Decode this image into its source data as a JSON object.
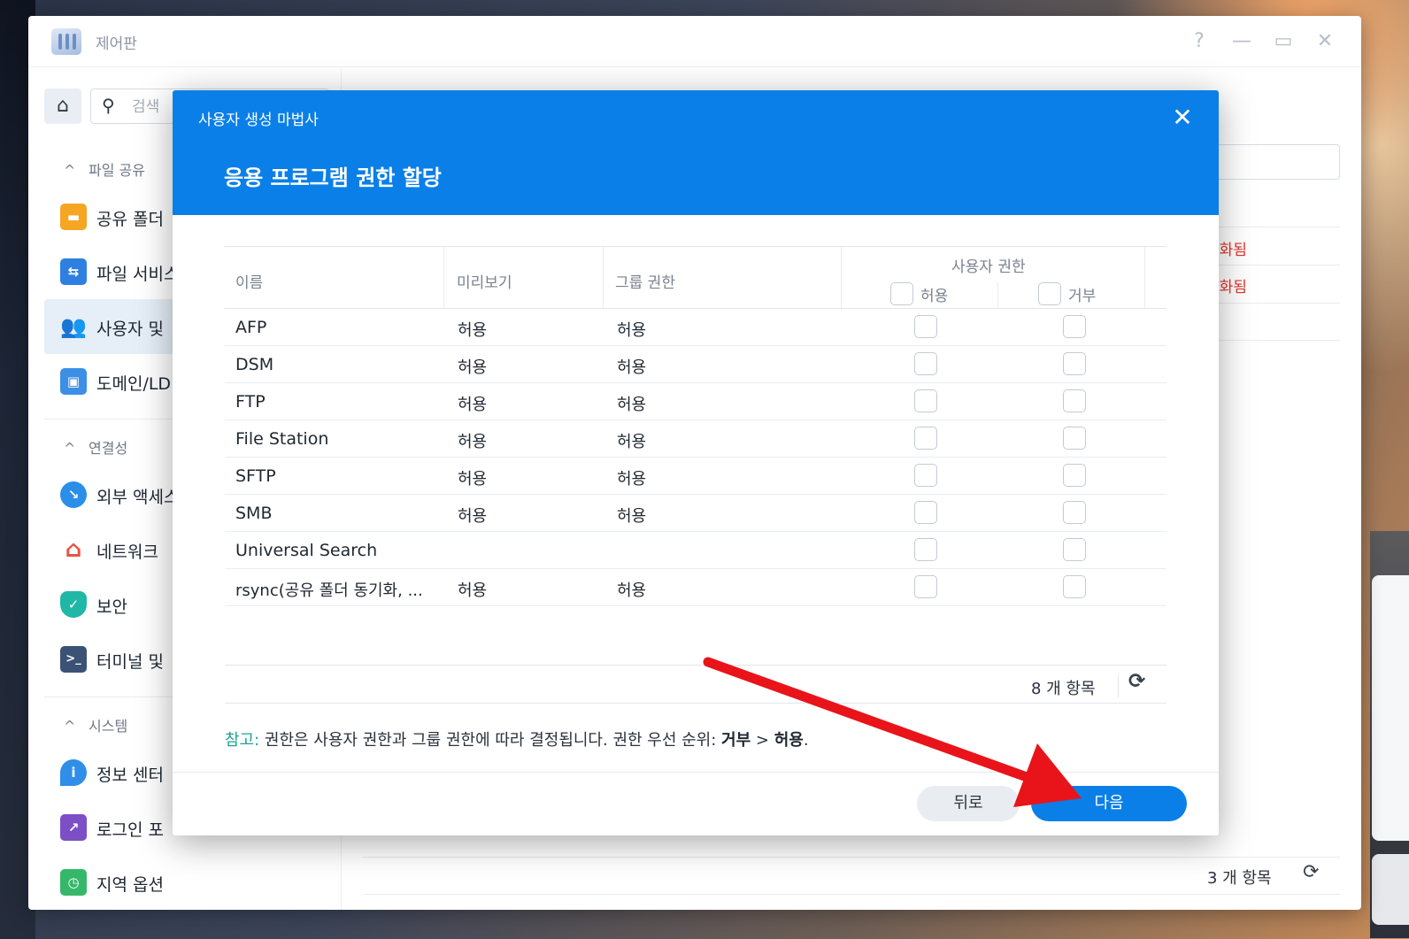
{
  "window": {
    "title": "제어판"
  },
  "sidebar": {
    "search_placeholder": "검색",
    "sections": [
      {
        "label": "파일 공유"
      },
      {
        "label": "연결성"
      },
      {
        "label": "시스템"
      }
    ],
    "items": [
      {
        "label": "공유 폴더"
      },
      {
        "label": "파일 서비스"
      },
      {
        "label": "사용자 및"
      },
      {
        "label": "도메인/LD"
      },
      {
        "label": "외부 액세스"
      },
      {
        "label": "네트워크"
      },
      {
        "label": "보안"
      },
      {
        "label": "터미널 및"
      },
      {
        "label": "정보 센터"
      },
      {
        "label": "로그인 포"
      },
      {
        "label": "지역 옵션"
      }
    ]
  },
  "background": {
    "status_1": "성화됨",
    "status_2": "성화됨",
    "footer_count": "3 개 항목"
  },
  "modal": {
    "wizard_title": "사용자 생성 마법사",
    "step_title": "응용 프로그램 권한 할당",
    "columns": {
      "name": "이름",
      "preview": "미리보기",
      "group_permission": "그룹 권한",
      "user_permission": "사용자 권한",
      "allow": "허용",
      "deny": "거부"
    },
    "rows": [
      {
        "name": "AFP",
        "preview": "허용",
        "group": "허용"
      },
      {
        "name": "DSM",
        "preview": "허용",
        "group": "허용"
      },
      {
        "name": "FTP",
        "preview": "허용",
        "group": "허용"
      },
      {
        "name": "File Station",
        "preview": "허용",
        "group": "허용"
      },
      {
        "name": "SFTP",
        "preview": "허용",
        "group": "허용"
      },
      {
        "name": "SMB",
        "preview": "허용",
        "group": "허용"
      },
      {
        "name": "Universal Search",
        "preview": "",
        "group": ""
      },
      {
        "name": "rsync(공유 폴더 동기화, ...",
        "preview": "허용",
        "group": "허용"
      }
    ],
    "item_count": "8 개 항목",
    "note": {
      "label": "참고:",
      "text": " 권한은 사용자 권한과 그룹 권한에 따라 결정됩니다. 권한 우선 순위: ",
      "deny": "거부",
      "gt": " > ",
      "allow": "허용",
      "end": "."
    },
    "back_button": "뒤로",
    "next_button": "다음"
  },
  "colors": {
    "accent": "#0a7fe8",
    "note_label": "#1ea393",
    "status_red": "#e3322b",
    "annotation_arrow": "#e8141a"
  }
}
